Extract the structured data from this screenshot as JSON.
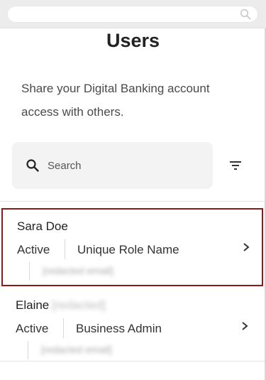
{
  "browser": {
    "search_icon": "search-icon"
  },
  "page": {
    "title": "Users",
    "intro": "Share your Digital Banking account access with others."
  },
  "search": {
    "placeholder": "Search",
    "value": "",
    "icon": "search-icon"
  },
  "filter": {
    "icon": "filter-icon"
  },
  "users": [
    {
      "name": "Sara Doe",
      "status": "Active",
      "role": "Unique Role Name",
      "email": "[redacted email]",
      "selected": true
    },
    {
      "name": "Elaine",
      "name_extra": "[redacted]",
      "status": "Active",
      "role": "Business Admin",
      "email": "[redacted email]",
      "selected": false
    }
  ],
  "colors": {
    "selection_border": "#8b1a1a",
    "search_bg": "#f3f3f3",
    "topbar_bg": "#ececec"
  }
}
